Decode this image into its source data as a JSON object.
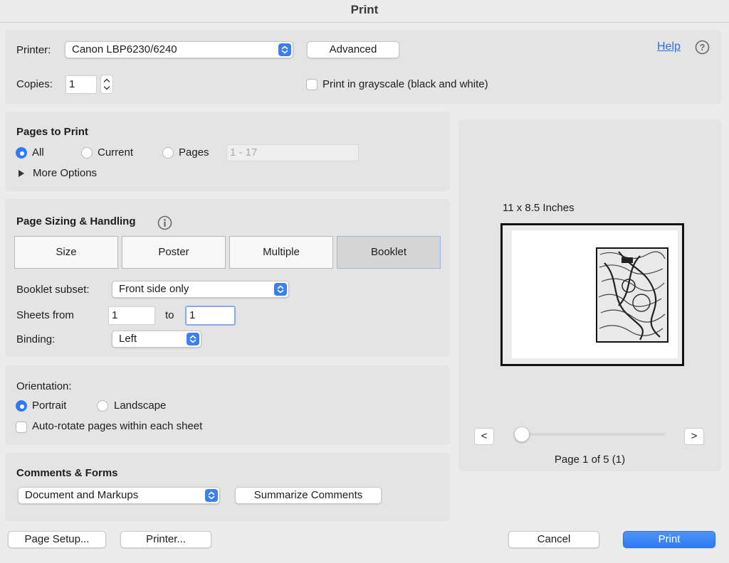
{
  "window": {
    "title": "Print"
  },
  "top": {
    "printer_label": "Printer:",
    "printer_value": "Canon LBP6230/6240",
    "advanced_label": "Advanced",
    "help_label": "Help",
    "copies_label": "Copies:",
    "copies_value": "1",
    "grayscale_label": "Print in grayscale (black and white)",
    "grayscale_checked": false
  },
  "pages_to_print": {
    "header": "Pages to Print",
    "options": [
      "All",
      "Current",
      "Pages"
    ],
    "selected": "All",
    "range_placeholder": "1 - 17",
    "more_options_label": "More Options"
  },
  "page_sizing": {
    "header": "Page Sizing & Handling",
    "modes": [
      "Size",
      "Poster",
      "Multiple",
      "Booklet"
    ],
    "selected_mode": "Booklet",
    "booklet_subset_label": "Booklet subset:",
    "booklet_subset_value": "Front side only",
    "sheets_from_label": "Sheets from",
    "sheets_from_value": "1",
    "sheets_to_label": "to",
    "sheets_to_value": "1",
    "binding_label": "Binding:",
    "binding_value": "Left"
  },
  "orientation": {
    "header": "Orientation:",
    "options": [
      "Portrait",
      "Landscape"
    ],
    "selected": "Portrait",
    "auto_rotate_label": "Auto-rotate pages within each sheet",
    "auto_rotate_checked": false
  },
  "comments_forms": {
    "header": "Comments & Forms",
    "select_value": "Document and Markups",
    "summarize_label": "Summarize Comments"
  },
  "preview": {
    "size_label": "11 x 8.5 Inches",
    "prev_label": "<",
    "next_label": ">",
    "page_status": "Page 1 of 5 (1)",
    "slider_fraction": 0
  },
  "footer": {
    "page_setup_label": "Page Setup...",
    "printer_label": "Printer...",
    "cancel_label": "Cancel",
    "print_label": "Print"
  },
  "colors": {
    "accent": "#2f7bf5",
    "link": "#2f6fdc"
  }
}
